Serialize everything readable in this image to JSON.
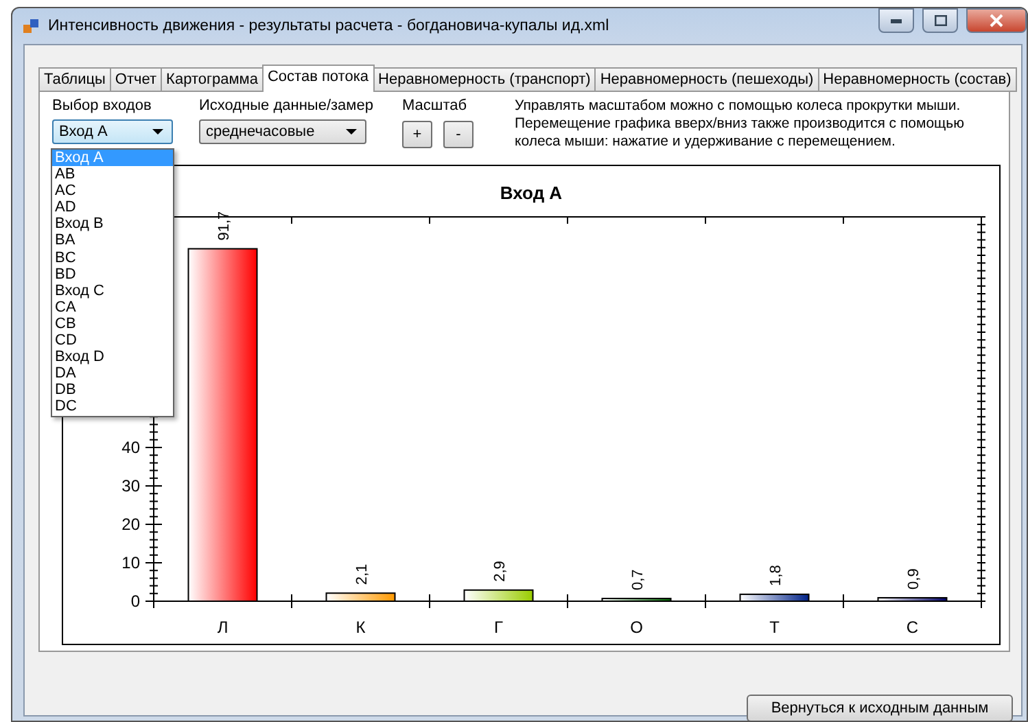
{
  "window": {
    "title": "Интенсивность движения - результаты расчета - богдановича-купалы ид.xml"
  },
  "tabs": [
    {
      "label": "Таблицы",
      "selected": false
    },
    {
      "label": "Отчет",
      "selected": false
    },
    {
      "label": "Картограмма",
      "selected": false
    },
    {
      "label": "Состав потока",
      "selected": true
    },
    {
      "label": "Неравномерность (транспорт)",
      "selected": false
    },
    {
      "label": "Неравномерность (пешеходы)",
      "selected": false
    },
    {
      "label": "Неравномерность (состав)",
      "selected": false
    }
  ],
  "entries": {
    "label": "Выбор входов",
    "value": "Вход А",
    "expanded": true,
    "options": [
      {
        "label": "Вход А",
        "selected": true
      },
      {
        "label": "AB",
        "selected": false
      },
      {
        "label": "AC",
        "selected": false
      },
      {
        "label": "AD",
        "selected": false
      },
      {
        "label": "Вход B",
        "selected": false
      },
      {
        "label": "BA",
        "selected": false
      },
      {
        "label": "BC",
        "selected": false
      },
      {
        "label": "BD",
        "selected": false
      },
      {
        "label": "Вход C",
        "selected": false
      },
      {
        "label": "CA",
        "selected": false
      },
      {
        "label": "CB",
        "selected": false
      },
      {
        "label": "CD",
        "selected": false
      },
      {
        "label": "Вход D",
        "selected": false
      },
      {
        "label": "DA",
        "selected": false
      },
      {
        "label": "DB",
        "selected": false
      },
      {
        "label": "DC",
        "selected": false
      }
    ]
  },
  "source": {
    "label": "Исходные данные/замер",
    "value": "среднечасовые"
  },
  "scale": {
    "label": "Масштаб",
    "buttons": [
      "+",
      "-"
    ]
  },
  "hint": "Управлять масштабом можно с помощью колеса прокрутки мыши.\nПеремещение графика вверх/вниз также производится с помощью\nколеса мыши: нажатие и удерживание с перемещением.",
  "chart": {
    "chart_data": {
      "type": "bar",
      "title": "Вход А",
      "categories": [
        "Л",
        "К",
        "Г",
        "О",
        "Т",
        "С"
      ],
      "series": [
        {
          "values": [
            91.7,
            2.1,
            2.9,
            0.7,
            1.8,
            0.9
          ]
        }
      ],
      "colors": [
        "#ff0000",
        "#ff9900",
        "#99cc00",
        "#006600",
        "#002288",
        "#000066"
      ],
      "value_labels": [
        "91,7",
        "2,1",
        "2,9",
        "0,7",
        "1,8",
        "0,9"
      ],
      "ylim": [
        0,
        100
      ],
      "yticks": [
        0,
        10,
        20,
        30,
        40
      ]
    }
  },
  "footer_button": "Вернуться к исходным данным"
}
